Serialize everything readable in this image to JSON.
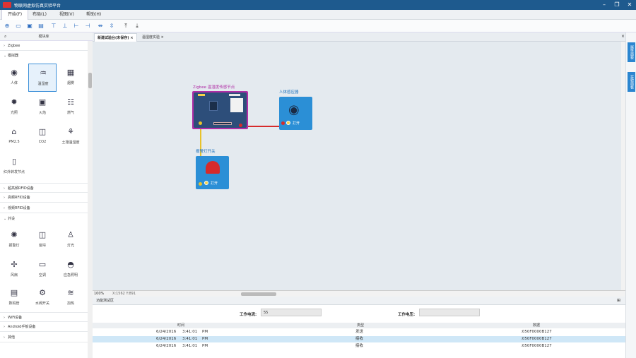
{
  "app": {
    "title": "物联网虚拟仿真实验平台"
  },
  "menu": [
    "开始(F)",
    "布局(L)",
    "视图(V)",
    "帮助(H)"
  ],
  "left_panel": {
    "header": "模块库",
    "zigbee": "Zigbee",
    "sensor_section": "模拟器",
    "sensors": [
      "人体",
      "温湿度",
      "烟雾",
      "光照",
      "火焰",
      "燃气",
      "PM2.5",
      "CO2",
      "土壤温湿度",
      "红外转发节点"
    ],
    "sections_mid": [
      "超高频RFID设备",
      "高频RFID设备",
      "低频RFID设备"
    ],
    "peripheral_section": "外设",
    "peripherals": [
      "报警灯",
      "窗帘",
      "灯光",
      "风扇",
      "空调",
      "应急照明",
      "数码管",
      "水阀开关",
      "加热"
    ],
    "sections_bottom": [
      "WiFi设备",
      "Android手板设备",
      "其他"
    ]
  },
  "tabs": [
    {
      "label": "新建试验台(未保存)"
    },
    {
      "label": "温湿度实验"
    }
  ],
  "canvas": {
    "node_zigbee": "Zigbee 温湿度传感节点",
    "node_human": "人体感应器",
    "node_alarm": "报警灯开关",
    "open_label": "打开"
  },
  "status": {
    "zoom": "100%",
    "coord": "X:1562 Y:891"
  },
  "right_tabs": [
    "属性面板",
    "实验面板"
  ],
  "test_panel": {
    "title": "功能测试区",
    "current_label": "工作电流:",
    "current_value": "55",
    "voltage_label": "工作电压:",
    "voltage_value": "",
    "columns": [
      "时间",
      "类型",
      "数据"
    ],
    "rows": [
      {
        "date": "6/24/2016",
        "time": "3:41:01",
        "ampm": "PM",
        "type": "发送",
        "data": ":050F0000B127"
      },
      {
        "date": "6/24/2016",
        "time": "3:41:01",
        "ampm": "PM",
        "type": "接收",
        "data": ":050F0000B127"
      },
      {
        "date": "6/24/2016",
        "time": "3:41:01",
        "ampm": "PM",
        "type": "接收",
        "data": ":050F0000B127"
      }
    ]
  },
  "colors": {
    "titlebar": "#1e5a8e",
    "accent": "#2b86d0",
    "node_border": "#b02ea6",
    "wire_red": "#d62b2b",
    "wire_yellow": "#e8c22a"
  }
}
